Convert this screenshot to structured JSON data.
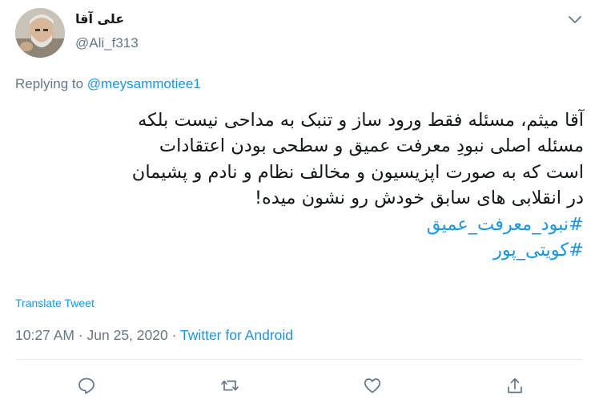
{
  "tweet": {
    "display_name": "علی آقا",
    "handle": "@Ali_f313",
    "replying_prefix": "Replying to ",
    "replying_to": "@meysammotiee1",
    "lines": [
      "آقا میثم، مسئله فقط ورود ساز و تنبک به مداحی نیست بلکه",
      "مسئله اصلی نبودِ معرفت عمیق و سطحی بودن اعتقادات",
      "است که به صورت اپزیسیون و مخالف نظام و نادم و پشیمان",
      "در انقلابی های سابق خودش رو نشون میده!"
    ],
    "hashtags": [
      "#نبود_معرفت_عمیق",
      "#کویتی_پور"
    ],
    "translate_label": "Translate Tweet",
    "time": "10:27 AM",
    "separator1": " · ",
    "date": "Jun 25, 2020",
    "separator2": " · ",
    "source": "Twitter for Android"
  },
  "icons": {
    "caret": "chevron-down-icon",
    "reply": "reply-icon",
    "retweet": "retweet-icon",
    "like": "heart-icon",
    "share": "share-icon"
  },
  "colors": {
    "accent": "#1b95e0",
    "secondary_text": "#657786",
    "primary_text": "#14171a",
    "divider": "#e6ecf0"
  }
}
